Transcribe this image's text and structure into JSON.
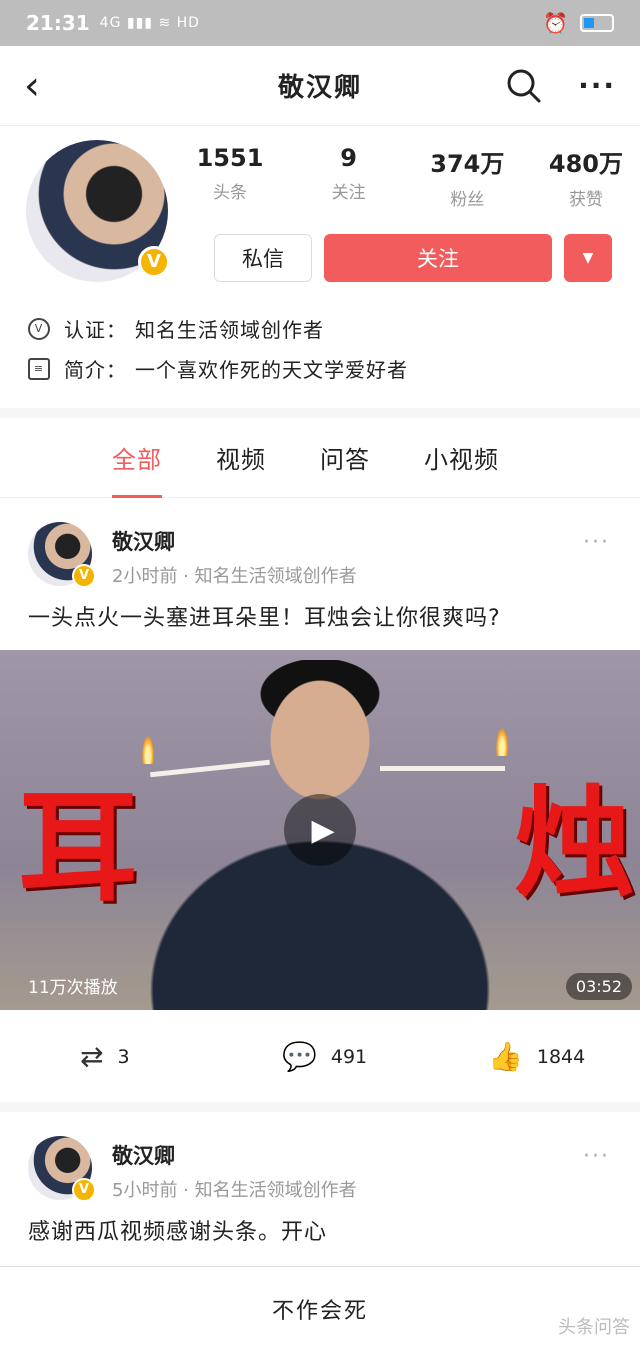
{
  "status_bar": {
    "time": "21:31",
    "signal": "4G ▮▮▮ ≋ HD"
  },
  "nav": {
    "title": "敬汉卿"
  },
  "profile": {
    "stats": [
      {
        "num": "1551",
        "label": "头条"
      },
      {
        "num": "9",
        "label": "关注"
      },
      {
        "num": "374万",
        "label": "粉丝"
      },
      {
        "num": "480万",
        "label": "获赞"
      }
    ],
    "message_label": "私信",
    "follow_label": "关注",
    "verify_label": "认证：",
    "verify_text": "知名生活领域创作者",
    "intro_label": "简介：",
    "intro_text": "一个喜欢作死的天文学爱好者"
  },
  "tabs": [
    "全部",
    "视频",
    "问答",
    "小视频"
  ],
  "posts": [
    {
      "author": "敬汉卿",
      "meta": "2小时前 · 知名生活领域创作者",
      "text": "一头点火一头塞进耳朵里！耳烛会让你很爽吗?",
      "video": {
        "left_char": "耳",
        "right_char": "烛",
        "plays": "11万次播放",
        "duration": "03:52"
      },
      "reposts": "3",
      "comments": "491",
      "likes": "1844"
    },
    {
      "author": "敬汉卿",
      "meta": "5小时前 · 知名生活领域创作者",
      "text": "感谢西瓜视频感谢头条。开心"
    }
  ],
  "bottom_bar": {
    "label": "不作会死"
  },
  "watermark": "头条问答",
  "colors": {
    "accent": "#f25c5c",
    "status_bar": "#bdbdbd",
    "badge": "#f5b400"
  }
}
